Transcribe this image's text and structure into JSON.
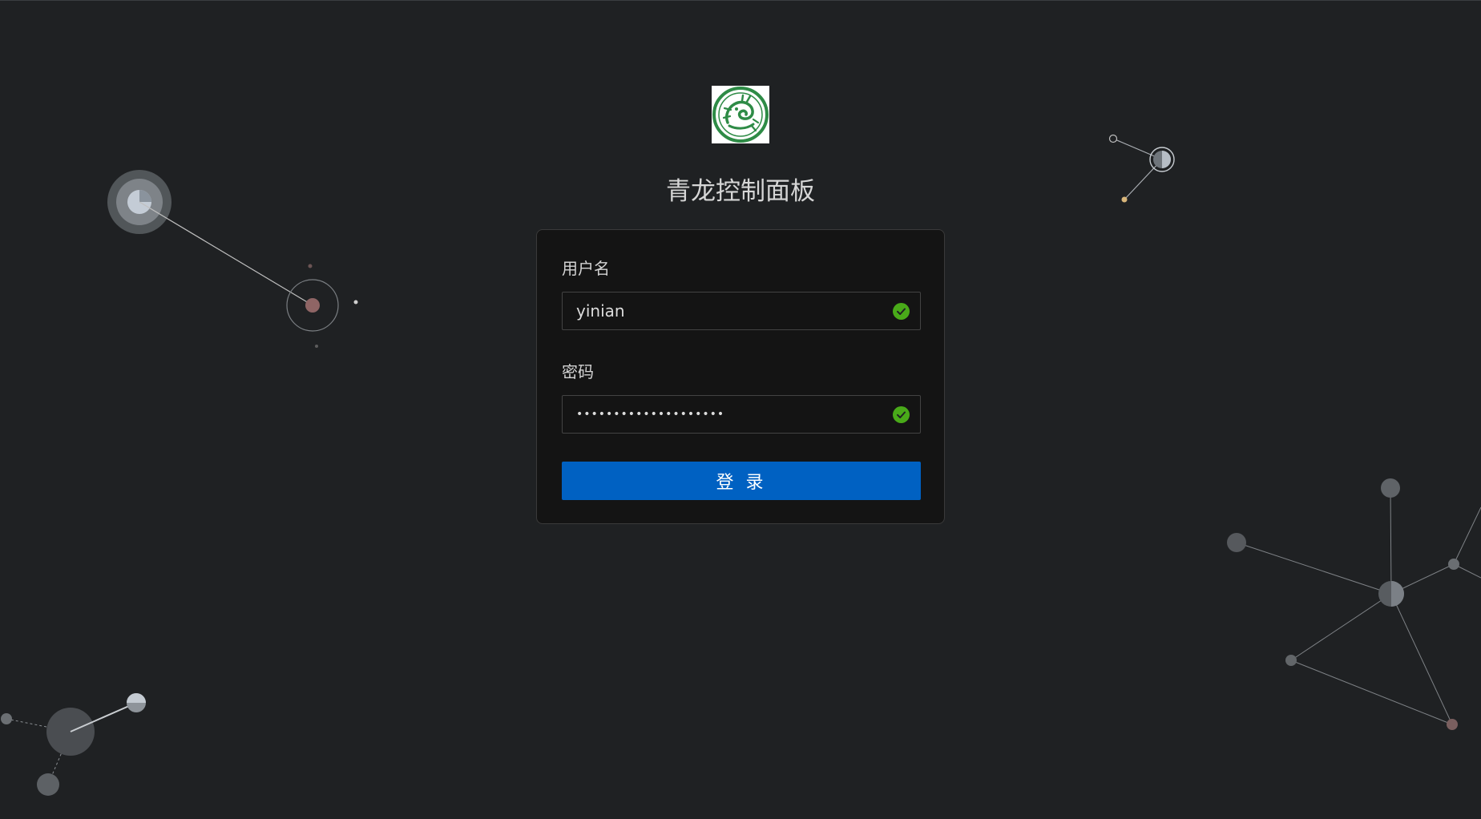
{
  "app": {
    "title": "青龙控制面板"
  },
  "form": {
    "username_label": "用户名",
    "username_value": "yinian",
    "password_label": "密码",
    "password_value": "••••••••••••••••••••",
    "login_label": "登 录"
  },
  "icons": {
    "logo": "qinglong-dragon-logo",
    "username_status": "check-circle-icon",
    "password_status": "check-circle-icon"
  },
  "colors": {
    "background": "#1f2123",
    "card": "#141414",
    "primary": "#0061c2",
    "success": "#49aa19"
  }
}
